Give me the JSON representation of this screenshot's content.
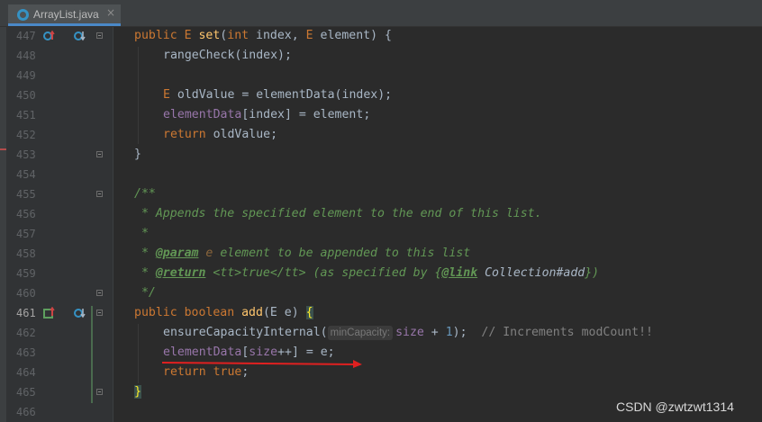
{
  "tab": {
    "label": "ArrayList.java",
    "close": "×",
    "icon": "java-class-icon"
  },
  "line_numbers": [
    "447",
    "448",
    "449",
    "450",
    "451",
    "452",
    "453",
    "454",
    "455",
    "456",
    "457",
    "458",
    "459",
    "460",
    "461",
    "462",
    "463",
    "464",
    "465",
    "466"
  ],
  "code": {
    "l447": {
      "kw1": "public ",
      "type": "E ",
      "fn": "set",
      "p1": "(",
      "kw2": "int",
      "p2": " index, ",
      "type2": "E",
      "p3": " element) {"
    },
    "l448": {
      "text": "rangeCheck(index);"
    },
    "l450": {
      "type": "E ",
      "text": "oldValue = elementData(index);"
    },
    "l451": {
      "field": "elementData",
      "text": "[index] = element;"
    },
    "l452": {
      "kw": "return ",
      "text": "oldValue;"
    },
    "l453": {
      "text": "}"
    },
    "l455": {
      "text": "/**"
    },
    "l456": {
      "text": " * Appends the specified element to the end of this list."
    },
    "l457": {
      "text": " *"
    },
    "l458": {
      "pre": " * ",
      "tag": "@param",
      "sp": " ",
      "arg": "e",
      "post": " element to be appended to this list"
    },
    "l459": {
      "pre": " * ",
      "tag": "@return",
      "p1": " <tt>true</tt> (as specified by {",
      "link": "@link",
      "sp": " ",
      "ref": "Collection#add",
      "p2": "})"
    },
    "l460": {
      "text": " */"
    },
    "l461": {
      "kw1": "public ",
      "kw2": "boolean ",
      "fn": "add",
      "p1": "(E e) ",
      "brace": "{"
    },
    "l462": {
      "call": "ensureCapacityInternal(",
      "hint": "minCapacity:",
      "field": "size",
      "op": " + ",
      "num": "1",
      "end": ");",
      "comment": "  // Increments modCount!!"
    },
    "l463": {
      "field1": "elementData",
      "p1": "[",
      "field2": "size",
      "p2": "++] = e;"
    },
    "l464": {
      "kw": "return ",
      "kw2": "true",
      "end": ";"
    },
    "l465": {
      "brace": "}"
    }
  },
  "watermark": "CSDN @zwtzwt1314",
  "colors": {
    "background": "#2b2b2b",
    "keyword": "#cc7832",
    "method": "#ffc66d",
    "field": "#9876aa",
    "doc_comment": "#629755",
    "annotation_arrow": "#e02020"
  }
}
